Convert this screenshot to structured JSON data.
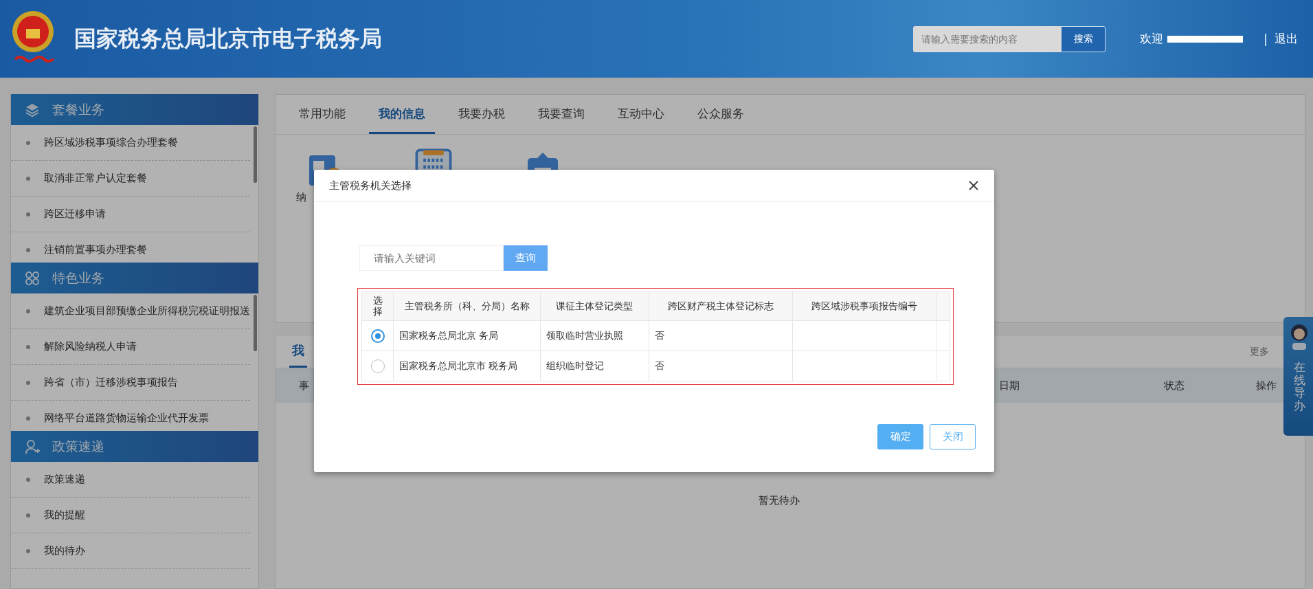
{
  "header": {
    "title": "国家税务总局北京市电子税务局",
    "search": {
      "placeholder": "请输入需要搜索的内容",
      "button": "搜索"
    },
    "welcome": "欢迎",
    "separator": "|",
    "logout": "退出"
  },
  "sidebar": {
    "sections": [
      {
        "kind": "layers",
        "title": "套餐业务",
        "items": [
          "跨区域涉税事项综合办理套餐",
          "取消非正常户认定套餐",
          "跨区迁移申请",
          "注销前置事项办理套餐"
        ]
      },
      {
        "kind": "grid",
        "title": "特色业务",
        "items": [
          "建筑企业项目部预缴企业所得税完税证明报送",
          "解除风险纳税人申请",
          "跨省（市）迁移涉税事项报告",
          "网络平台道路货物运输企业代开发票"
        ]
      },
      {
        "kind": "user",
        "title": "政策速递",
        "items": [
          "政策速递",
          "我的提醒",
          "我的待办"
        ]
      }
    ]
  },
  "tabs": [
    {
      "label": "常用功能",
      "selected": false
    },
    {
      "label": "我的信息",
      "selected": true
    },
    {
      "label": "我要办税",
      "selected": false
    },
    {
      "label": "我要查询",
      "selected": false
    },
    {
      "label": "互动中心",
      "selected": false
    },
    {
      "label": "公众服务",
      "selected": false
    }
  ],
  "shortcuts": [
    {
      "kind": "receipt",
      "label": "纳"
    },
    {
      "kind": "scanner"
    },
    {
      "kind": "briefcase"
    }
  ],
  "todo_panel": {
    "tab": "我",
    "more": "更多",
    "columns": [
      "事",
      "日期",
      "状态",
      "操作"
    ],
    "empty": "暂无待办"
  },
  "helper": {
    "label": "在线导办"
  },
  "dialog": {
    "title": "主管税务机关选择",
    "search": {
      "placeholder": "请输入关键词",
      "button": "查询"
    },
    "table": {
      "columns": [
        "选择",
        "主管税务所（科、分局）名称",
        "课征主体登记类型",
        "跨区财产税主体登记标志",
        "跨区域涉税事项报告编号"
      ],
      "rows": [
        {
          "selected": true,
          "cells": [
            "",
            "国家税务总局北京 务局",
            "领取临时营业执照",
            "否"
          ]
        },
        {
          "selected": false,
          "cells": [
            "",
            "国家税务总局北京市 税务局",
            "组织临时登记",
            "否"
          ]
        }
      ]
    },
    "buttons": [
      {
        "kind": "primary",
        "label": "确定"
      },
      {
        "kind": "secondary",
        "label": "关闭"
      }
    ]
  }
}
